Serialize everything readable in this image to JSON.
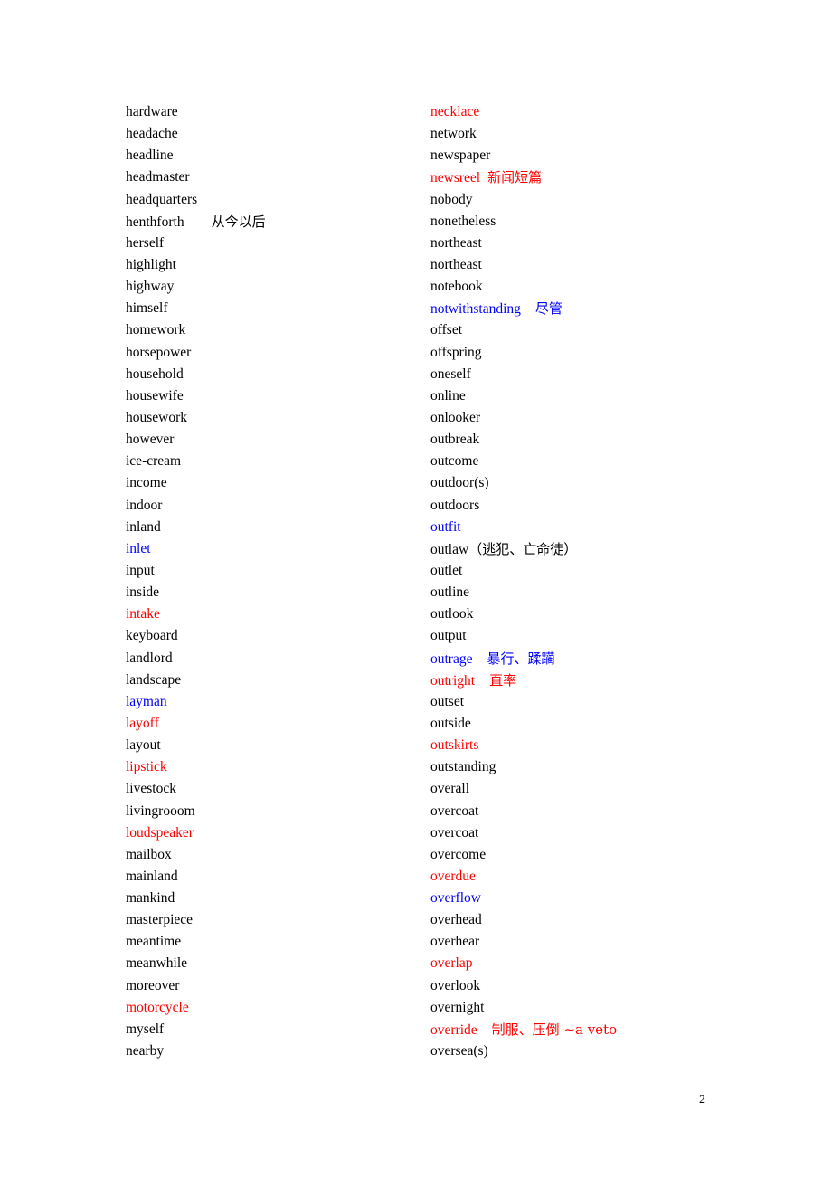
{
  "left_column": [
    {
      "word": "hardware",
      "note": "",
      "color": "black"
    },
    {
      "word": "headache",
      "note": "",
      "color": "black"
    },
    {
      "word": "headline",
      "note": "",
      "color": "black"
    },
    {
      "word": "headmaster",
      "note": "",
      "color": "black"
    },
    {
      "word": "headquarters",
      "note": "",
      "color": "black"
    },
    {
      "word": "henthforth",
      "note": "从今以后",
      "color": "black"
    },
    {
      "word": "herself",
      "note": "",
      "color": "black"
    },
    {
      "word": "highlight",
      "note": "",
      "color": "black"
    },
    {
      "word": "highway",
      "note": "",
      "color": "black"
    },
    {
      "word": "himself",
      "note": "",
      "color": "black"
    },
    {
      "word": "homework",
      "note": "",
      "color": "black"
    },
    {
      "word": "horsepower",
      "note": "",
      "color": "black"
    },
    {
      "word": "household",
      "note": "",
      "color": "black"
    },
    {
      "word": "housewife",
      "note": "",
      "color": "black"
    },
    {
      "word": "housework",
      "note": "",
      "color": "black"
    },
    {
      "word": "however",
      "note": "",
      "color": "black"
    },
    {
      "word": "ice-cream",
      "note": "",
      "color": "black"
    },
    {
      "word": "income",
      "note": "",
      "color": "black"
    },
    {
      "word": "indoor",
      "note": "",
      "color": "black"
    },
    {
      "word": "inland",
      "note": "",
      "color": "black"
    },
    {
      "word": "inlet",
      "note": "",
      "color": "blue"
    },
    {
      "word": "input",
      "note": "",
      "color": "black"
    },
    {
      "word": "inside",
      "note": "",
      "color": "black"
    },
    {
      "word": "intake",
      "note": "",
      "color": "red"
    },
    {
      "word": "keyboard",
      "note": "",
      "color": "black"
    },
    {
      "word": "landlord",
      "note": "",
      "color": "black"
    },
    {
      "word": "landscape",
      "note": "",
      "color": "black"
    },
    {
      "word": "layman",
      "note": "",
      "color": "blue"
    },
    {
      "word": "layoff",
      "note": "",
      "color": "red"
    },
    {
      "word": "layout",
      "note": "",
      "color": "black"
    },
    {
      "word": "lipstick",
      "note": "",
      "color": "red"
    },
    {
      "word": "livestock",
      "note": "",
      "color": "black"
    },
    {
      "word": "livingrooom",
      "note": "",
      "color": "black"
    },
    {
      "word": "loudspeaker",
      "note": "",
      "color": "red"
    },
    {
      "word": "mailbox",
      "note": "",
      "color": "black"
    },
    {
      "word": "mainland",
      "note": "",
      "color": "black"
    },
    {
      "word": "mankind",
      "note": "",
      "color": "black"
    },
    {
      "word": "masterpiece",
      "note": "",
      "color": "black"
    },
    {
      "word": "meantime",
      "note": "",
      "color": "black"
    },
    {
      "word": "meanwhile",
      "note": "",
      "color": "black"
    },
    {
      "word": "moreover",
      "note": "",
      "color": "black"
    },
    {
      "word": "motorcycle",
      "note": "",
      "color": "red"
    },
    {
      "word": "myself",
      "note": "",
      "color": "black"
    },
    {
      "word": "nearby",
      "note": "",
      "color": "black"
    }
  ],
  "right_column": [
    {
      "word": "necklace",
      "note": "",
      "color": "red"
    },
    {
      "word": "network",
      "note": "",
      "color": "black"
    },
    {
      "word": "newspaper",
      "note": "",
      "color": "black"
    },
    {
      "word": "newsreel",
      "note": "新闻短篇",
      "color": "red"
    },
    {
      "word": "nobody",
      "note": "",
      "color": "black"
    },
    {
      "word": "nonetheless",
      "note": "",
      "color": "black"
    },
    {
      "word": "northeast",
      "note": "",
      "color": "black"
    },
    {
      "word": "northeast",
      "note": "",
      "color": "black"
    },
    {
      "word": "notebook",
      "note": "",
      "color": "black"
    },
    {
      "word": "notwithstanding",
      "note": "尽管",
      "color": "blue"
    },
    {
      "word": "offset",
      "note": "",
      "color": "black"
    },
    {
      "word": "offspring",
      "note": "",
      "color": "black"
    },
    {
      "word": "oneself",
      "note": "",
      "color": "black"
    },
    {
      "word": "online",
      "note": "",
      "color": "black"
    },
    {
      "word": "onlooker",
      "note": "",
      "color": "black"
    },
    {
      "word": "outbreak",
      "note": "",
      "color": "black"
    },
    {
      "word": "outcome",
      "note": "",
      "color": "black"
    },
    {
      "word": "outdoor(s)",
      "note": "",
      "color": "black"
    },
    {
      "word": "outdoors",
      "note": "",
      "color": "black"
    },
    {
      "word": "outfit",
      "note": "",
      "color": "blue"
    },
    {
      "word": "outlaw",
      "note": "（逃犯、亡命徒）",
      "color": "black"
    },
    {
      "word": "outlet",
      "note": "",
      "color": "black"
    },
    {
      "word": "outline",
      "note": "",
      "color": "black"
    },
    {
      "word": "outlook",
      "note": "",
      "color": "black"
    },
    {
      "word": "output",
      "note": "",
      "color": "black"
    },
    {
      "word": "outrage",
      "note": "暴行、蹂躏",
      "color": "blue"
    },
    {
      "word": "outright",
      "note": "直率",
      "color": "red"
    },
    {
      "word": "outset",
      "note": "",
      "color": "black"
    },
    {
      "word": "outside",
      "note": "",
      "color": "black"
    },
    {
      "word": "outskirts",
      "note": "",
      "color": "red"
    },
    {
      "word": "outstanding",
      "note": "",
      "color": "black"
    },
    {
      "word": "overall",
      "note": "",
      "color": "black"
    },
    {
      "word": "overcoat",
      "note": "",
      "color": "black"
    },
    {
      "word": "overcoat",
      "note": "",
      "color": "black"
    },
    {
      "word": "overcome",
      "note": "",
      "color": "black"
    },
    {
      "word": "overdue",
      "note": "",
      "color": "red"
    },
    {
      "word": "overflow",
      "note": "",
      "color": "blue"
    },
    {
      "word": "overhead",
      "note": "",
      "color": "black"
    },
    {
      "word": "overhear",
      "note": "",
      "color": "black"
    },
    {
      "word": "overlap",
      "note": "",
      "color": "red"
    },
    {
      "word": "overlook",
      "note": "",
      "color": "black"
    },
    {
      "word": "overnight",
      "note": "",
      "color": "black"
    },
    {
      "word": "override",
      "note": "制服、压倒  ~a veto",
      "color": "red"
    },
    {
      "word": "oversea(s)",
      "note": "",
      "color": "black"
    }
  ],
  "page_number": "2"
}
